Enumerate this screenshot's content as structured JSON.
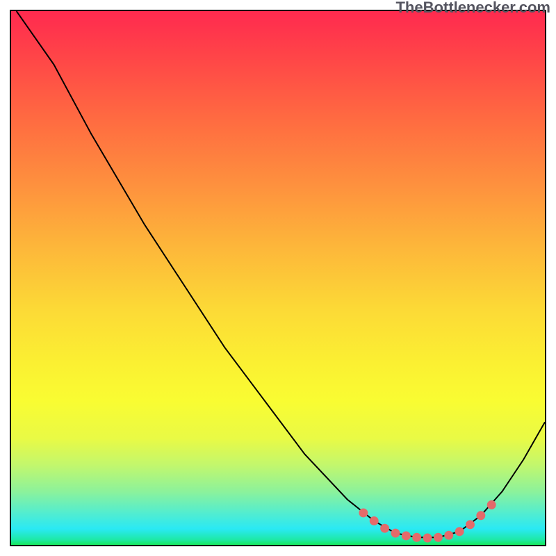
{
  "watermark": "TheBottlenecker.com",
  "chart_data": {
    "type": "line",
    "title": "",
    "xlabel": "",
    "ylabel": "",
    "xlim": [
      0,
      100
    ],
    "ylim": [
      0,
      100
    ],
    "series": [
      {
        "name": "main-curve",
        "stroke": "#000000",
        "stroke_width": 2,
        "points": [
          {
            "x": 1,
            "y": 100
          },
          {
            "x": 8,
            "y": 90
          },
          {
            "x": 15,
            "y": 77
          },
          {
            "x": 25,
            "y": 60
          },
          {
            "x": 40,
            "y": 37
          },
          {
            "x": 55,
            "y": 17
          },
          {
            "x": 63,
            "y": 8.5
          },
          {
            "x": 68,
            "y": 4.5
          },
          {
            "x": 72,
            "y": 2.2
          },
          {
            "x": 76,
            "y": 1.4
          },
          {
            "x": 80,
            "y": 1.4
          },
          {
            "x": 84,
            "y": 2.5
          },
          {
            "x": 88,
            "y": 5.5
          },
          {
            "x": 92,
            "y": 10
          },
          {
            "x": 96,
            "y": 16
          },
          {
            "x": 100,
            "y": 23
          }
        ]
      },
      {
        "name": "emphasis-dots",
        "stroke": "#E46A6A",
        "marker": "circle",
        "points": [
          {
            "x": 66,
            "y": 6.0
          },
          {
            "x": 68,
            "y": 4.5
          },
          {
            "x": 70,
            "y": 3.1
          },
          {
            "x": 72,
            "y": 2.2
          },
          {
            "x": 74,
            "y": 1.7
          },
          {
            "x": 76,
            "y": 1.4
          },
          {
            "x": 78,
            "y": 1.3
          },
          {
            "x": 80,
            "y": 1.4
          },
          {
            "x": 82,
            "y": 1.8
          },
          {
            "x": 84,
            "y": 2.5
          },
          {
            "x": 86,
            "y": 3.8
          },
          {
            "x": 88,
            "y": 5.5
          },
          {
            "x": 90,
            "y": 7.5
          }
        ]
      }
    ],
    "background": {
      "type": "vertical-gradient-red-to-green",
      "description": "red at top through orange/yellow to green at bottom"
    }
  }
}
